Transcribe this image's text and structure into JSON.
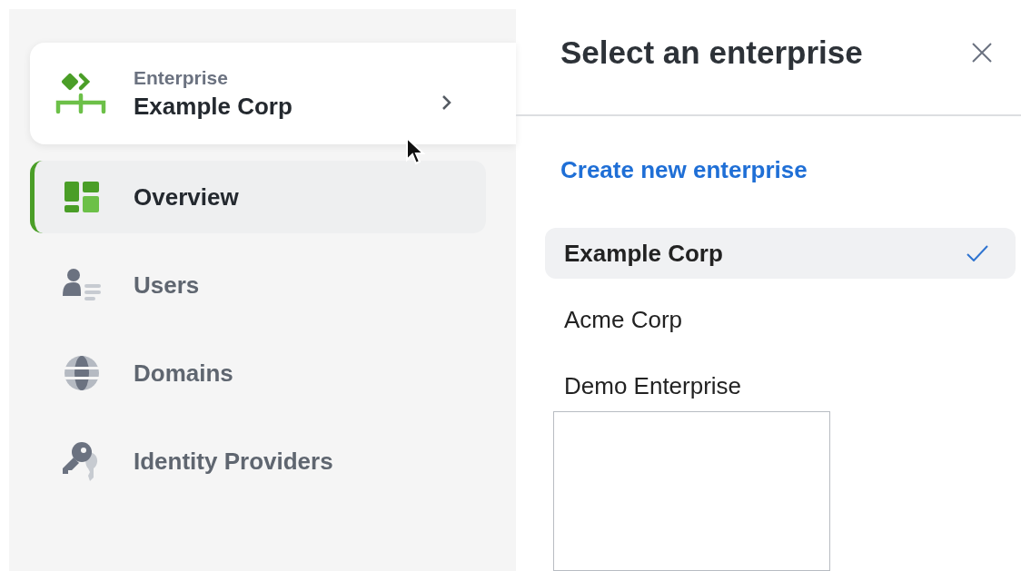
{
  "sidebar": {
    "enterprise": {
      "label": "Enterprise",
      "name": "Example Corp"
    },
    "items": [
      {
        "label": "Overview",
        "selected": true
      },
      {
        "label": "Users",
        "selected": false
      },
      {
        "label": "Domains",
        "selected": false
      },
      {
        "label": "Identity Providers",
        "selected": false
      }
    ]
  },
  "panel": {
    "title": "Select an enterprise",
    "create_link": "Create new enterprise",
    "enterprises": [
      {
        "name": "Example Corp",
        "selected": true
      },
      {
        "name": "Acme Corp",
        "selected": false
      },
      {
        "name": "Demo Enterprise",
        "selected": false
      }
    ]
  }
}
